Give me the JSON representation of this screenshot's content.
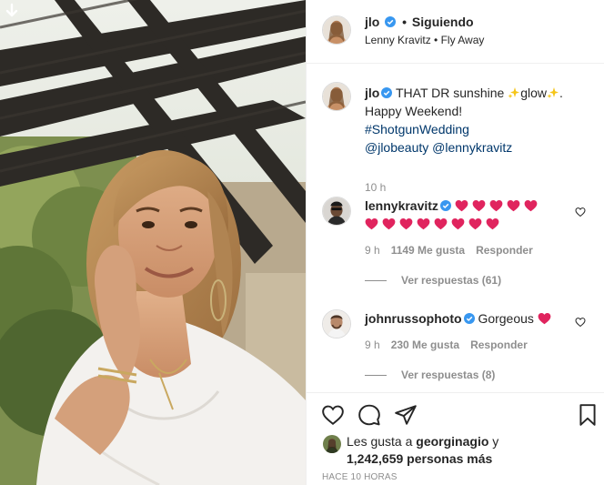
{
  "post": {
    "username": "jlo",
    "dot": "•",
    "follow_status": "Siguiendo",
    "audio": "Lenny Kravitz • Fly Away"
  },
  "caption": {
    "username": "jlo",
    "text_before": "THAT DR sunshine ",
    "text_middle": "glow",
    "text_after": ".",
    "line2": "Happy Weekend!",
    "hashtag": "#ShotgunWedding",
    "mention1": "@jlobeauty",
    "mention2": "@lennykravitz",
    "time": "10 h"
  },
  "comments": [
    {
      "username": "lennykravitz",
      "heart_count": 13,
      "time": "9 h",
      "likes": "1149 Me gusta",
      "reply": "Responder",
      "view_replies": "Ver respuestas (61)"
    },
    {
      "username": "johnrussophoto",
      "text": "Gorgeous",
      "heart_count": 1,
      "time": "9 h",
      "likes": "230 Me gusta",
      "reply": "Responder",
      "view_replies": "Ver respuestas (8)"
    }
  ],
  "likes": {
    "prefix": "Les gusta a ",
    "user": "georginagio",
    "joiner": " y",
    "count": "1,242,659 personas más"
  },
  "timestamp": "HACE 10 HORAS",
  "icons": {
    "like": "heart-outline-icon",
    "comment": "comment-bubble-icon",
    "share": "paper-plane-icon",
    "save": "bookmark-icon",
    "verified": "verified-badge-icon",
    "download": "arrow-down-icon"
  },
  "colors": {
    "link": "#00376b",
    "verified": "#3897f0",
    "heart": "#e0245e",
    "muted": "#8e8e8e"
  }
}
